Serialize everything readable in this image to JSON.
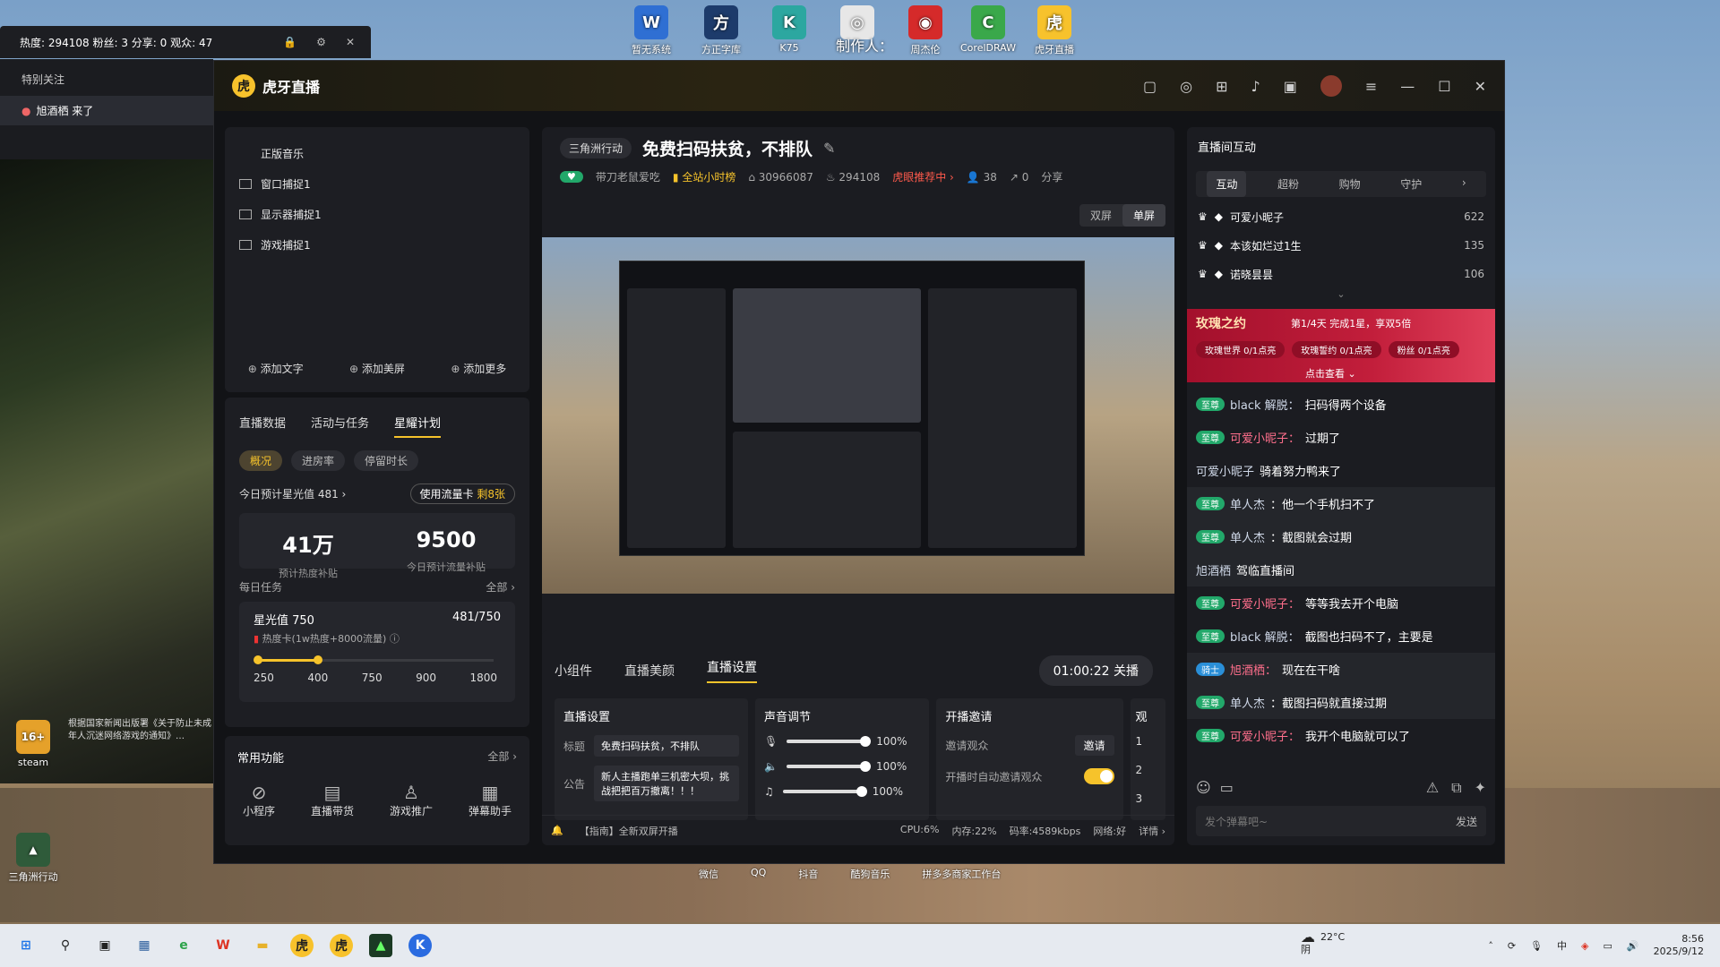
{
  "desktop": {
    "top_icons": [
      {
        "label": "暂无系统",
        "glyph": "W",
        "color": "#2f6fd3"
      },
      {
        "label": "方正字库",
        "glyph": "方",
        "color": "#1d3b6b"
      },
      {
        "label": "K75",
        "glyph": "K",
        "color": "#2ca7a0"
      },
      {
        "label": "",
        "glyph": "◎",
        "color": "#e7e7e7"
      },
      {
        "label": "制作人：",
        "glyph": "",
        "color": "#ffffff"
      },
      {
        "label": "周杰伦",
        "glyph": "◉",
        "color": "#d52a2a"
      },
      {
        "label": "CorelDRAW",
        "glyph": "C",
        "color": "#3aa84a"
      },
      {
        "label": "虎牙直播",
        "glyph": "虎",
        "color": "#f7c22c"
      }
    ],
    "side_icons": [
      {
        "label": "steam",
        "glyph": "16+",
        "color": "#e5a12a"
      },
      {
        "label": "三角洲行动",
        "glyph": "▲",
        "color": "#2f5b3a"
      }
    ],
    "notice_text": "根据国家新闻出版署《关于防止未成年人沉迷网络游戏的通知》…",
    "taskbar_labels": [
      "微信",
      "QQ",
      "抖音",
      "酷狗音乐",
      "拼多多商家工作台"
    ]
  },
  "mini_window": {
    "stats": "热度: 294108   粉丝: 3   分享: 0   观众: 47",
    "follow_title": "特别关注",
    "follow_item": "旭酒栖 来了"
  },
  "window": {
    "app_title": "虎牙直播"
  },
  "scenes": {
    "items": [
      "正版音乐",
      "窗口捕捉1",
      "显示器捕捉1",
      "游戏捕捉1"
    ],
    "actions": [
      "添加文字",
      "添加美屏",
      "添加更多"
    ]
  },
  "data_panel": {
    "tabs": [
      "直播数据",
      "活动与任务",
      "星耀计划"
    ],
    "pills": [
      "概况",
      "进房率",
      "停留时长"
    ],
    "star_today": "今日预计星光值 481 ›",
    "flow_card_btn": "使用流量卡",
    "flow_card_badge": "剩8张",
    "big1_value": "41万",
    "big1_label": "预计热度补贴",
    "big2_value": "9500",
    "big2_label": "今日预计流量补贴",
    "daily_title": "每日任务",
    "daily_all": "全部 ›",
    "task_title": "星光值 750",
    "task_progress": "481/750",
    "task_progress_fraction": 0.641,
    "task_sub": "热度卡(1w热度+8000流量)",
    "ticks": [
      "250",
      "400",
      "750",
      "900",
      "1800"
    ]
  },
  "functions": {
    "title": "常用功能",
    "all": "全部 ›",
    "items": [
      "小程序",
      "直播带货",
      "游戏推广",
      "弹幕助手"
    ]
  },
  "room": {
    "category": "三角洲行动",
    "title": "免费扫码扶贫，不排队",
    "streamer": "带刀老鼠爱吃",
    "hour_rank": "全站小时榜",
    "room_id": "30966087",
    "heat": "294108",
    "recommend": "虎眼推荐中 ›",
    "viewers": "38",
    "shares": "0",
    "share_label": "分享",
    "mode_dual": "双屏",
    "mode_single": "单屏"
  },
  "bottom": {
    "tabs": [
      "小组件",
      "直播美颜",
      "直播设置"
    ],
    "end_btn": "01:00:22 关播",
    "settings_title": "直播设置",
    "label_title": "标题",
    "value_title": "免费扫码扶贫，不排队",
    "label_notice": "公告",
    "value_notice": "新人主播跑单三机密大坝，挑战把把百万撤离！！！",
    "volume_title": "声音调节",
    "volumes": [
      "100%",
      "100%",
      "100%"
    ],
    "invite_title": "开播邀请",
    "invite_viewers": "邀请观众",
    "invite_btn": "邀请",
    "auto_invite": "开播时自动邀请观众",
    "watch_title": "观",
    "watch_nums": [
      "1",
      "2",
      "3"
    ],
    "tip": "【指南】全新双屏开播",
    "cpu": "CPU:6%",
    "mem": "内存:22%",
    "bitrate": "码率:4589kbps",
    "network": "网络:好",
    "detail": "详情 ›"
  },
  "chat": {
    "title": "直播间互动",
    "tabs": [
      "互动",
      "超粉",
      "购物",
      "守护"
    ],
    "ranks": [
      {
        "name": "可爱小昵子",
        "score": "622"
      },
      {
        "name": "本该如烂过1生",
        "score": "135"
      },
      {
        "name": "诺晓昙昙",
        "score": "106"
      }
    ],
    "banner_title": "玫瑰之约",
    "banner_sub": "第1/4天   完成1星，享双5倍",
    "banner_items": [
      "玫瑰世界 0/1点亮",
      "玫瑰誓约 0/1点亮",
      "粉丝 0/1点亮"
    ],
    "banner_more": "点击查看 ⌄",
    "messages": [
      {
        "level": "至尊",
        "name": "black 解脱：",
        "text": "扫码得两个设备",
        "pink": false,
        "hl": false
      },
      {
        "level": "至尊",
        "name": "可爱小昵子：",
        "text": "过期了",
        "pink": true,
        "hl": false
      },
      {
        "level": "",
        "name": "可爱小昵子",
        "text": "骑着努力鸭来了",
        "pink": false,
        "hl": false
      },
      {
        "level": "至尊",
        "name": "单人杰",
        "text": "：他一个手机扫不了",
        "pink": false,
        "hl": true
      },
      {
        "level": "至尊",
        "name": "单人杰",
        "text": "：截图就会过期",
        "pink": false,
        "hl": true
      },
      {
        "level": "",
        "name": "旭酒栖",
        "text": "驾临直播间",
        "pink": false,
        "hl": true
      },
      {
        "level": "至尊",
        "name": "可爱小昵子：",
        "text": "等等我去开个电脑",
        "pink": true,
        "hl": false
      },
      {
        "level": "至尊",
        "name": "black 解脱：",
        "text": "截图也扫码不了，主要是",
        "pink": false,
        "hl": false
      },
      {
        "level": "骑士",
        "name": "旭酒栖：",
        "text": "现在在干啥",
        "pink": true,
        "hl": true
      },
      {
        "level": "至尊",
        "name": "单人杰",
        "text": "：截图扫码就直接过期",
        "pink": false,
        "hl": true
      },
      {
        "level": "至尊",
        "name": "可爱小昵子：",
        "text": "我开个电脑就可以了",
        "pink": true,
        "hl": false
      }
    ],
    "input_placeholder": "发个弹幕吧~",
    "send": "发送"
  },
  "tray": {
    "weather_temp": "22°C",
    "weather_desc": "阴",
    "time": "8:56",
    "date": "2025/9/12"
  },
  "colors": {
    "accent": "#f6c32b",
    "panel": "#1d1e23",
    "chat_badge": "#22a86a"
  }
}
